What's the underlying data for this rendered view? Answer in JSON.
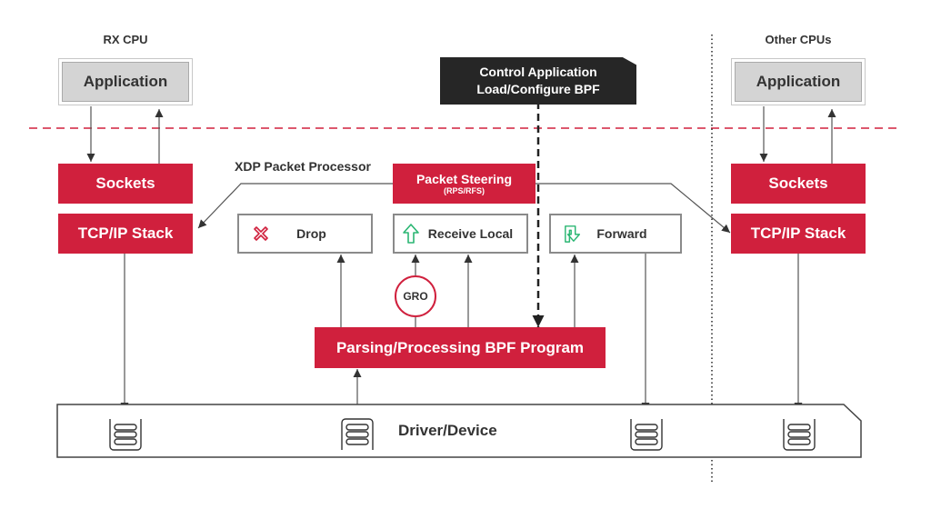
{
  "colors": {
    "accent_red": "#d0203d",
    "dark": "#262626",
    "gray_box": "#d4d4d4",
    "xdp_bg": "#d9d9d9",
    "green_icon": "#2bb673"
  },
  "regions": {
    "rx_cpu_label": "RX CPU",
    "other_cpus_label": "Other CPUs"
  },
  "rx_cpu": {
    "application": "Application",
    "sockets": "Sockets",
    "tcpip": "TCP/IP Stack"
  },
  "other_cpus": {
    "application": "Application",
    "sockets": "Sockets",
    "tcpip": "TCP/IP Stack"
  },
  "control": {
    "line1": "Control Application",
    "line2": "Load/Configure BPF"
  },
  "xdp": {
    "title": "XDP Packet Processor",
    "steering": {
      "label": "Packet Steering",
      "sub": "(RPS/RFS)"
    },
    "actions": [
      {
        "label": "Drop",
        "icon": "x-icon"
      },
      {
        "label": "Receive Local",
        "icon": "up-arrow-icon"
      },
      {
        "label": "Forward",
        "icon": "forward-arrow-icon"
      }
    ],
    "gro": "GRO",
    "program": "Parsing/Processing BPF Program"
  },
  "driver": {
    "label": "Driver/Device"
  }
}
